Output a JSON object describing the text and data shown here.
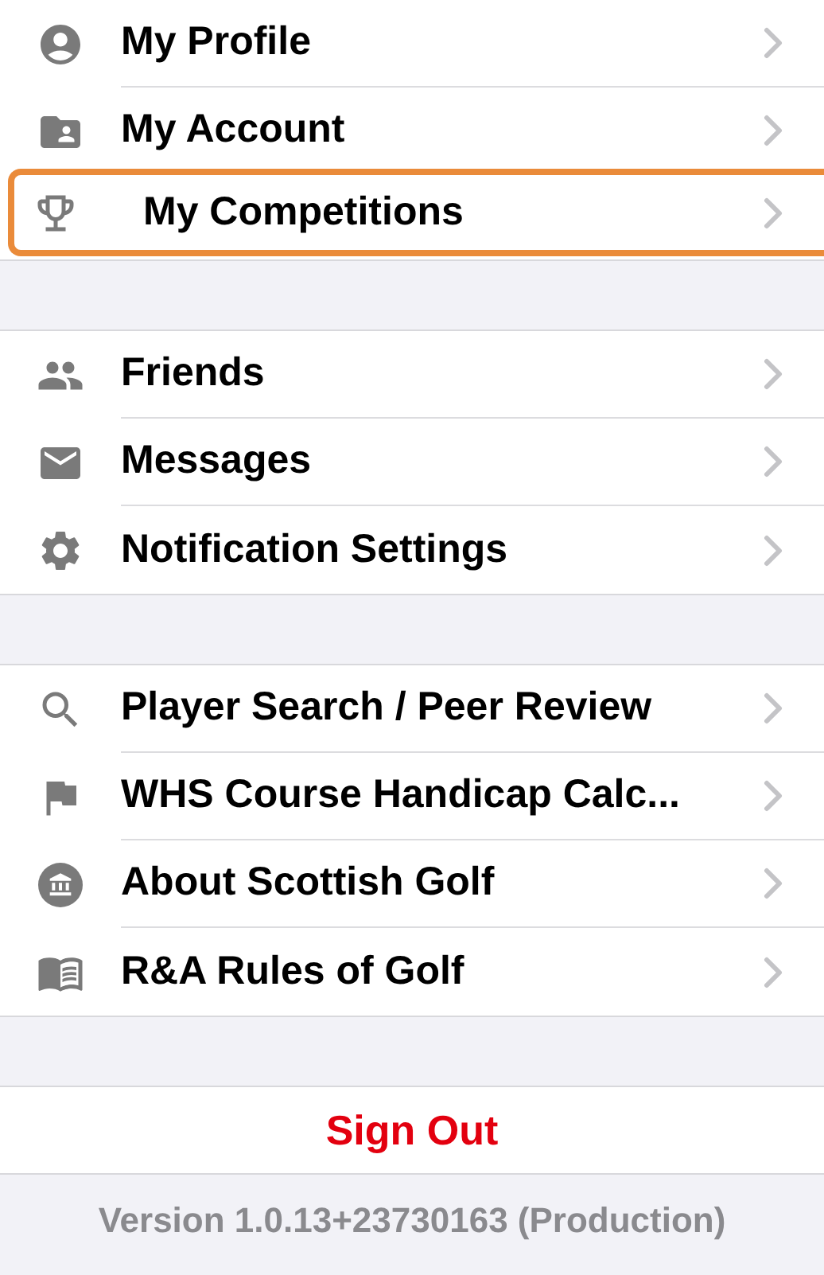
{
  "sections": [
    {
      "items": [
        {
          "label": "My Profile",
          "highlighted": false
        },
        {
          "label": "My Account",
          "highlighted": false
        },
        {
          "label": "My Competitions",
          "highlighted": true
        }
      ]
    },
    {
      "items": [
        {
          "label": "Friends",
          "highlighted": false
        },
        {
          "label": "Messages",
          "highlighted": false
        },
        {
          "label": "Notification Settings",
          "highlighted": false
        }
      ]
    },
    {
      "items": [
        {
          "label": "Player Search / Peer Review",
          "highlighted": false
        },
        {
          "label": "WHS Course Handicap Calc...",
          "highlighted": false
        },
        {
          "label": "About Scottish Golf",
          "highlighted": false
        },
        {
          "label": "R&A Rules of Golf",
          "highlighted": false
        }
      ]
    }
  ],
  "sign_out": "Sign Out",
  "version": "Version 1.0.13+23730163 (Production)"
}
